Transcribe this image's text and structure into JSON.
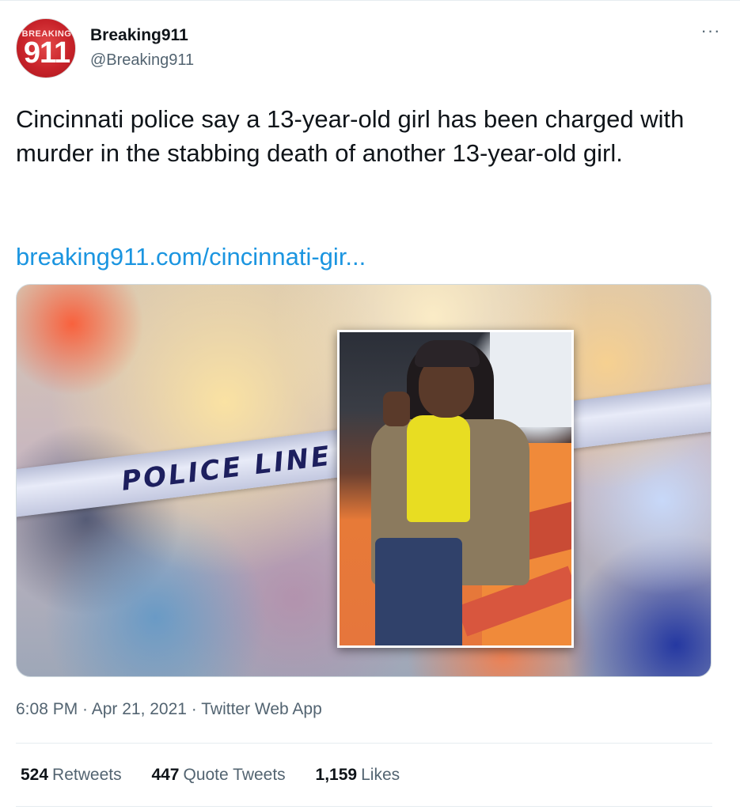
{
  "author": {
    "avatar_top_text": "BREAKING",
    "avatar_number": "911",
    "display_name": "Breaking911",
    "handle": "@Breaking911"
  },
  "more_glyph": "···",
  "tweet": {
    "text": "Cincinnati police say a 13-year-old girl has been charged with murder in the stabbing death of another 13-year-old girl.",
    "link": "breaking911.com/cincinnati-gir..."
  },
  "media": {
    "tape_text": "POLICE LINE"
  },
  "meta": {
    "timestamp": "6:08 PM · Apr 21, 2021 · Twitter Web App"
  },
  "stats": {
    "retweets_count": "524",
    "retweets_label": "Retweets",
    "quotes_count": "447",
    "quotes_label": "Quote Tweets",
    "likes_count": "1,159",
    "likes_label": "Likes"
  },
  "colors": {
    "link": "#1b95e0",
    "secondary_text": "#536471",
    "brand_red": "#c8232a"
  }
}
